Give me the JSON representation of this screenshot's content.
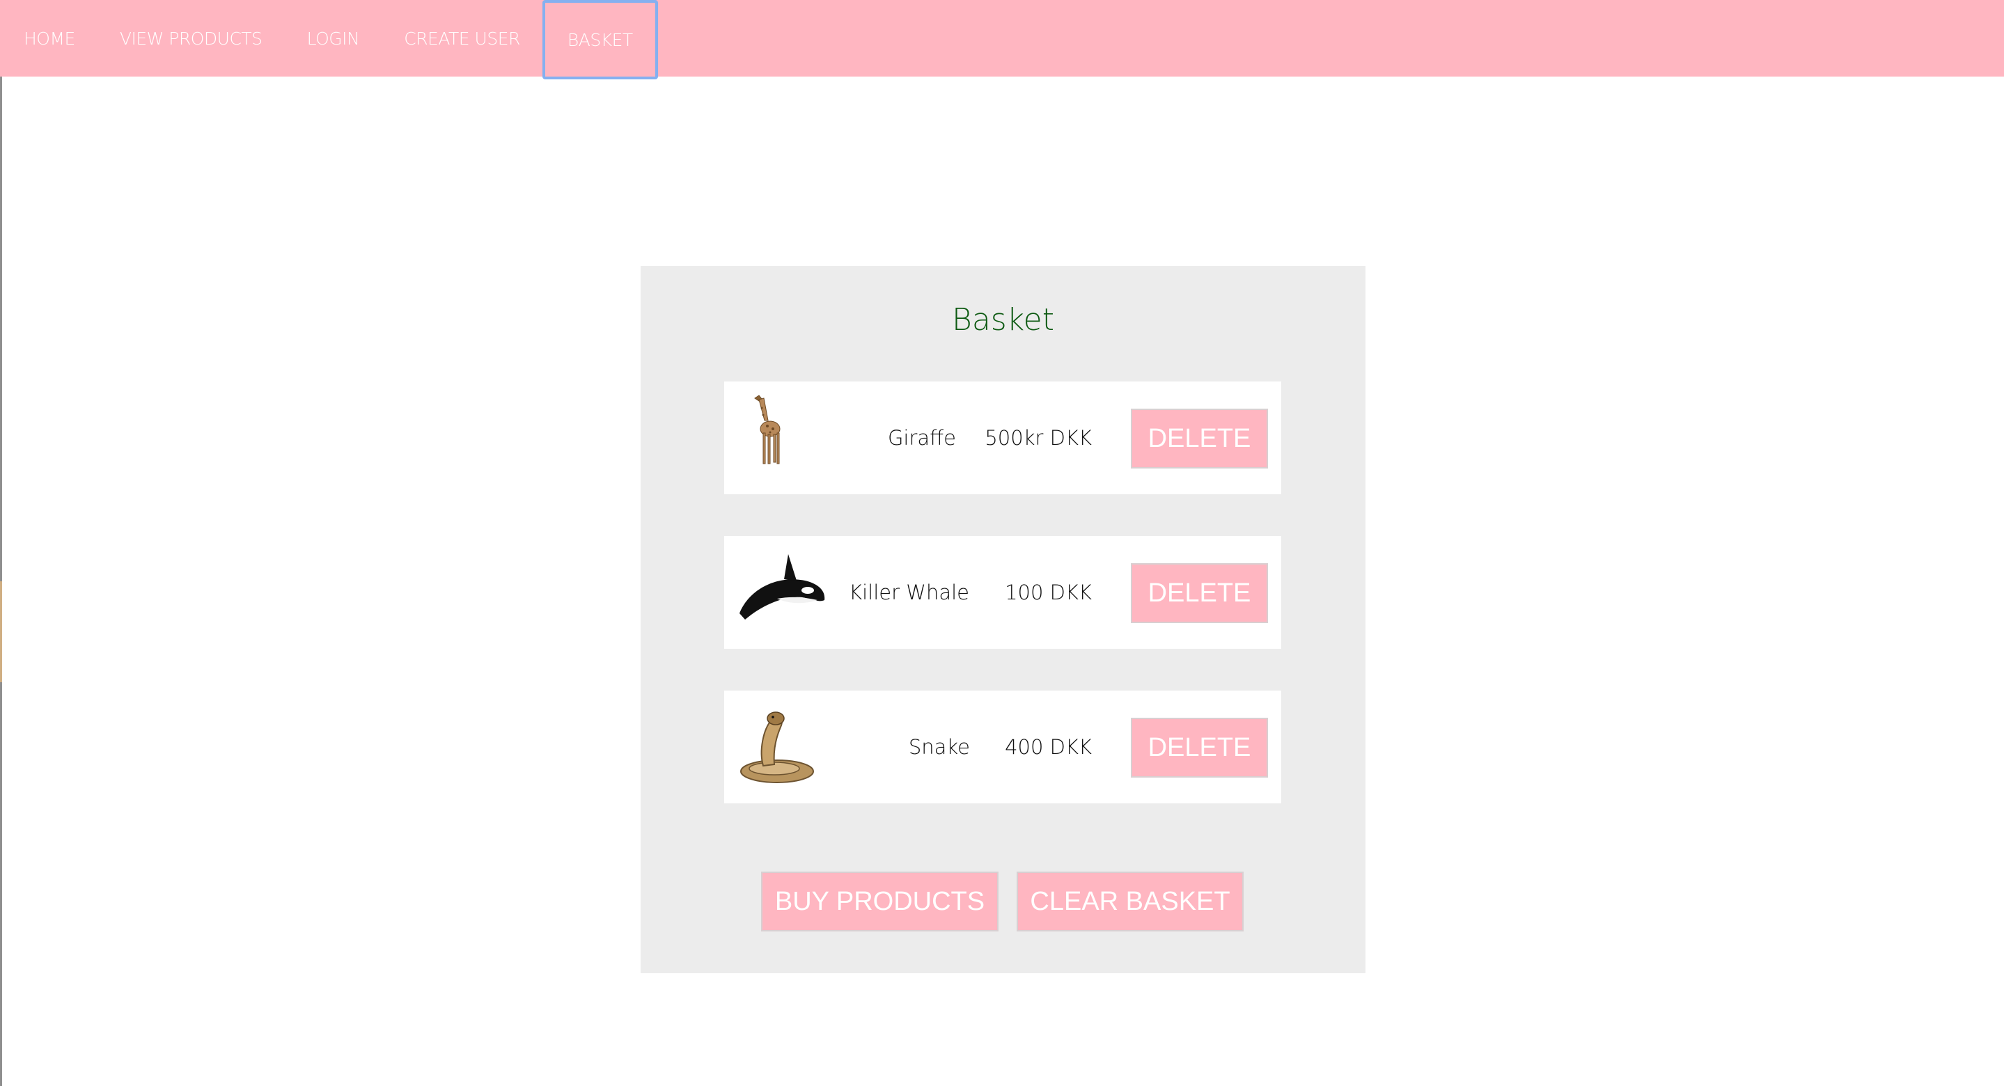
{
  "nav": {
    "items": [
      {
        "label": "HOME"
      },
      {
        "label": "VIEW PRODUCTS"
      },
      {
        "label": "LOGIN"
      },
      {
        "label": "CREATE USER"
      },
      {
        "label": "BASKET",
        "active": true
      }
    ]
  },
  "basket": {
    "title": "Basket",
    "items": [
      {
        "name": "Giraffe",
        "price": "500kr DKK",
        "image": "giraffe-image",
        "delete_label": "DELETE"
      },
      {
        "name": "Killer Whale",
        "price": "100 DKK",
        "image": "killer-whale-image",
        "delete_label": "DELETE"
      },
      {
        "name": "Snake",
        "price": "400 DKK",
        "image": "snake-image",
        "delete_label": "DELETE"
      }
    ],
    "buy_label": "BUY PRODUCTS",
    "clear_label": "CLEAR BASKET"
  },
  "colors": {
    "nav_bg": "#ffb6c1",
    "panel_bg": "#ececec",
    "title": "#0d5a12",
    "button_bg": "#ffb6c1",
    "active_outline": "#85b0f0"
  }
}
